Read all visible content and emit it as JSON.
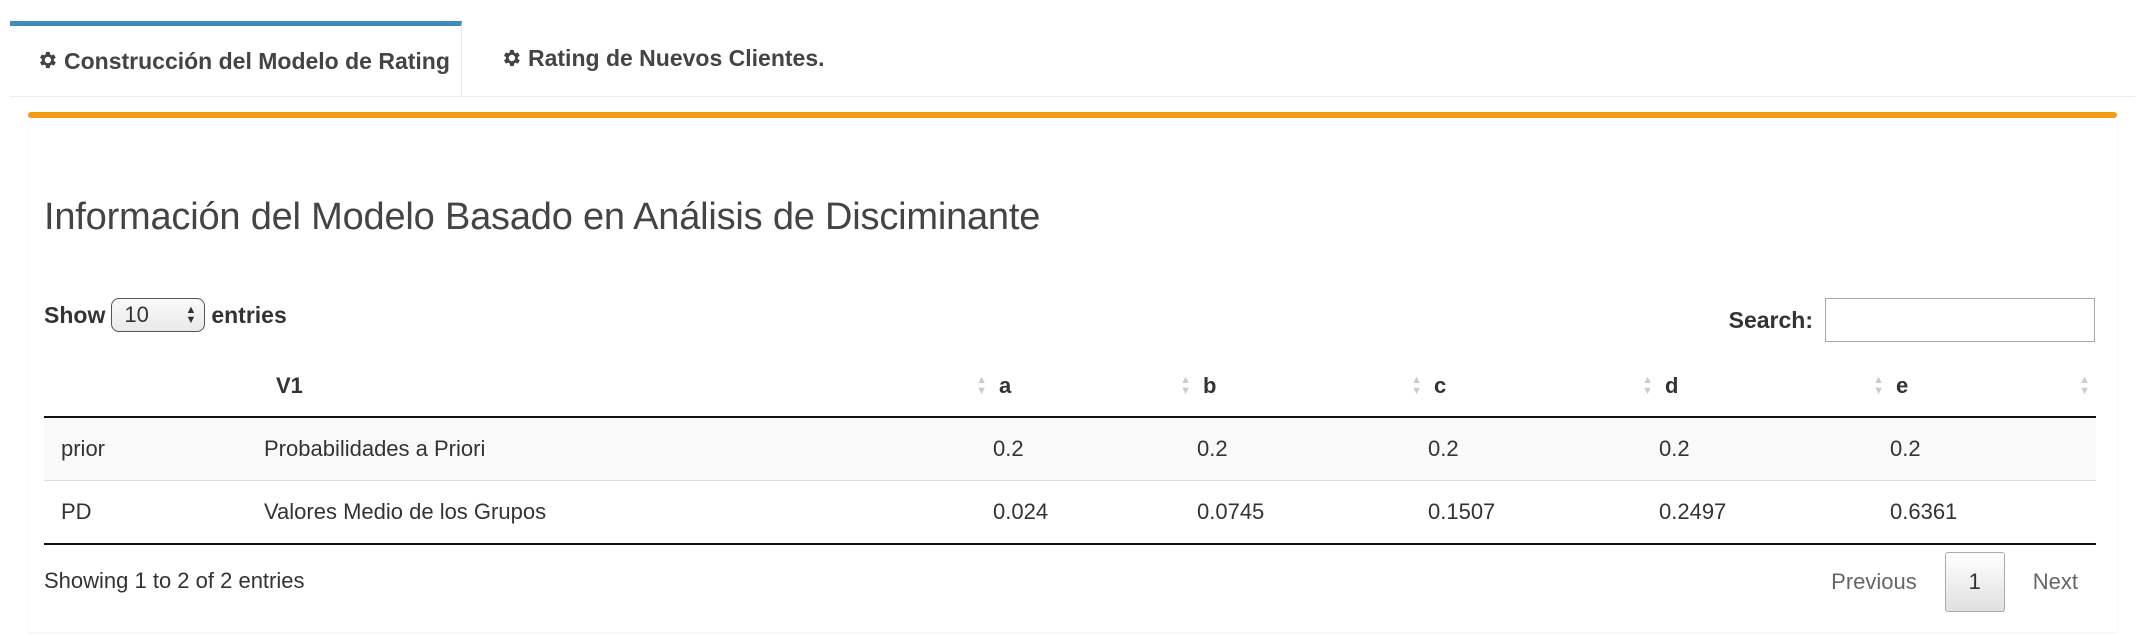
{
  "tabs": [
    {
      "label": "Construcción del Modelo de Rating",
      "icon": "gear-icon",
      "active": true
    },
    {
      "label": "Rating de Nuevos Clientes.",
      "icon": "gear-icon",
      "active": false
    }
  ],
  "panel": {
    "accent_color": "#f39c12",
    "title": "Información del Modelo Basado en Análisis de Disciminante"
  },
  "table_controls": {
    "show_label": "Show",
    "entries_label": "entries",
    "page_length": "10",
    "search_label": "Search:",
    "search_value": ""
  },
  "table": {
    "columns": [
      "",
      "V1",
      "a",
      "b",
      "c",
      "d",
      "e"
    ],
    "rows": [
      [
        "prior",
        "Probabilidades a Priori",
        "0.2",
        "0.2",
        "0.2",
        "0.2",
        "0.2"
      ],
      [
        "PD",
        "Valores Medio de los Grupos",
        "0.024",
        "0.0745",
        "0.1507",
        "0.2497",
        "0.6361"
      ]
    ]
  },
  "footer": {
    "info": "Showing 1 to 2 of 2 entries",
    "previous": "Previous",
    "current_page": "1",
    "next": "Next"
  },
  "colors": {
    "tab_active_border": "#3c8dbc",
    "box_accent": "#f39c12"
  }
}
